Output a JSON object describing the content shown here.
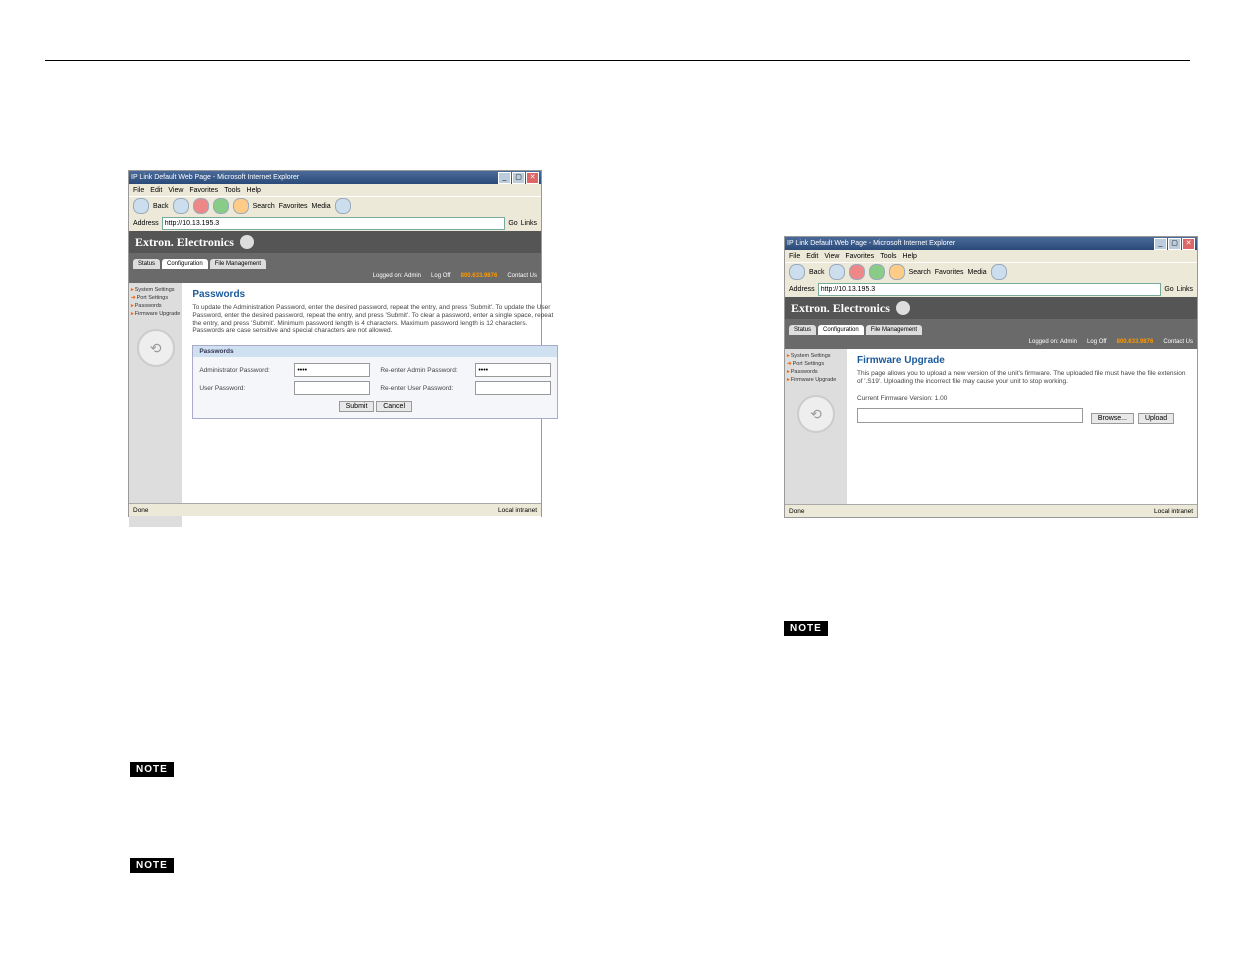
{
  "window": {
    "title": "IP Link Default Web Page - Microsoft Internet Explorer",
    "min": "_",
    "max": "▢",
    "close": "✕"
  },
  "menu": [
    "File",
    "Edit",
    "View",
    "Favorites",
    "Tools",
    "Help"
  ],
  "toolbar": {
    "back": "Back",
    "search": "Search",
    "favorites": "Favorites",
    "media": "Media"
  },
  "address": {
    "label": "Address",
    "value_left": "http://10.13.195.3",
    "value_right": "http://10.13.195.3",
    "go": "Go",
    "links": "Links"
  },
  "brand": "Extron. Electronics",
  "tabs": {
    "status": "Status",
    "config": "Configuration",
    "filemgmt": "File Management"
  },
  "topright": {
    "logged": "Logged on:",
    "admin": "Admin",
    "logoff": "Log Off",
    "contact": "Contact Us",
    "code_left": "800.633.9876",
    "code_right": "800.633.9876"
  },
  "sidebar": {
    "items": [
      "System Settings",
      "Port Settings",
      "Passwords",
      "Firmware Upgrade"
    ]
  },
  "passwords": {
    "heading": "Passwords",
    "intro": "To update the Administration Password, enter the desired password, repeat the entry, and press 'Submit'.  To update the User Password, enter the desired password, repeat the entry, and press 'Submit'.  To clear a password, enter a single space, repeat the entry, and press 'Submit'.  Minimum password length is 4 characters.  Maximum password length is 12 characters.  Passwords are case sensitive and special characters are not allowed.",
    "box_hdr": "Passwords",
    "admin_label": "Administrator Password:",
    "admin_val": "••••",
    "re_admin_label": "Re-enter Admin Password:",
    "re_admin_val": "••••",
    "user_label": "User Password:",
    "re_user_label": "Re-enter User Password:",
    "submit": "Submit",
    "cancel": "Cancel"
  },
  "firmware": {
    "heading": "Firmware Upgrade",
    "intro": "This page allows you to upload a new version of the unit's firmware. The uploaded file must have the file extension of '.S19'. Uploading the incorrect file may cause your unit to stop working.",
    "cur": "Current Firmware Version: 1.00",
    "browse": "Browse...",
    "upload": "Upload"
  },
  "status": {
    "done": "Done",
    "intranet": "Local intranet"
  },
  "note": "NOTE"
}
